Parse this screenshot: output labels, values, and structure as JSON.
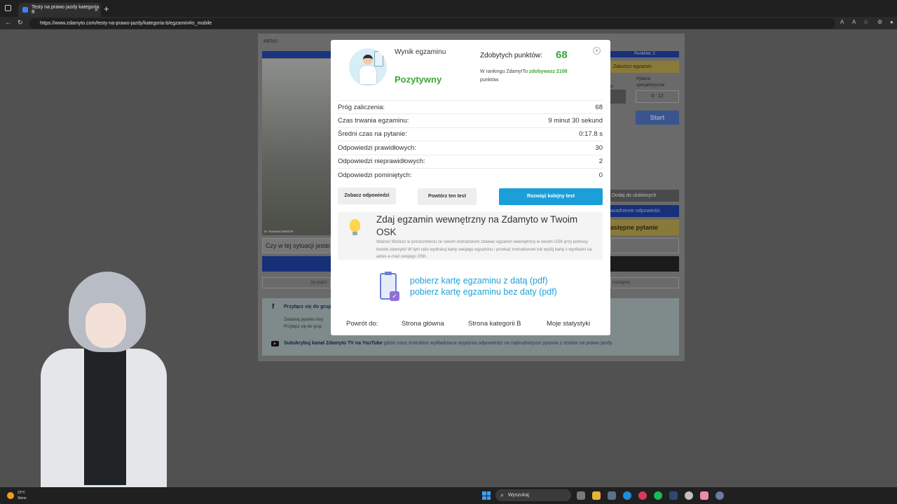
{
  "browser": {
    "tab_title": "Testy na prawo jazdy kategoria B",
    "tab_close": "×",
    "new_tab": "+",
    "url": "https://www.zdamyto.com/testy-na-prawo-jazdy/kategoria-b/egzamin#is_mobile"
  },
  "background_page": {
    "menu_label": "MENU",
    "question_text": "Czy w tej sytuacji jesteś",
    "prev_label": "(k) poprz",
    "next_label": "następne",
    "photo_caption": "ID: 3118/2A/C3/000278",
    "right": {
      "points_label": "Punktów: 2",
      "finish_button": "Zakończ egzamin",
      "basic_label": "e:",
      "special_label": "Pytania specjalistyczne",
      "timer": "0 : 12",
      "start_button": "Start",
      "favorites_button": "Dodaj do ulubionych",
      "justification_button": "asadnienie odpowiedzi",
      "next_question_button": "astępne pytanie"
    },
    "social": {
      "join_header": "Przyłącz się do grup",
      "join_line1": "Zadawaj pytania inny",
      "join_line2": "Przyłącz się do grup",
      "yt_bold": "Subskrybuj kanał Zdamyto TV na YouTube",
      "yt_rest": " gdzie nasz instruktor wykładowca wyjaśnia odpowiedzi na najtrudniejsze pytania z testów na prawo jazdy."
    }
  },
  "modal": {
    "result_label": "Wynik egzaminu",
    "result_status": "Pozytywny",
    "points_label": "Zdobytych punktów:",
    "points_value": "68",
    "ranking_prefix": "W rankingu Zdamy!To ",
    "ranking_bold": "zdobywasz 2108",
    "ranking_suffix": " punktów.",
    "close_symbol": "×",
    "stats": [
      {
        "label": "Próg zaliczenia:",
        "value": "68"
      },
      {
        "label": "Czas trwania egzaminu:",
        "value": "9 minut 30 sekund"
      },
      {
        "label": "Średni czas na pytanie:",
        "value": "0:17.8 s"
      },
      {
        "label": "Odpowiedzi prawidłowych:",
        "value": "30"
      },
      {
        "label": "Odpowiedzi nieprawidłowych:",
        "value": "2"
      },
      {
        "label": "Odpowiedzi pominiętych:",
        "value": "0"
      }
    ],
    "buttons": {
      "show_answers": "Zobacz odpowiedzi",
      "repeat_test": "Powtórz ten test",
      "next_test": "Rozwiąż kolejny test"
    },
    "osk": {
      "title": "Zdaj egzamin wewnętrzny na Zdamyto w Twoim OSK",
      "desc": "Ważne! Możesz w porozumieniu ze swoim instruktorem zdawać egzamin wewnętrzny w swoim OSK przy pomocy testów zdamyto! W tym celu wydrukuj kartę swojego egzaminu i przekaż instruktorowi lub wyślij kartę z wynikami na adres e-mail swojego OSK."
    },
    "pdf_with_date": "pobierz kartę egzaminu z datą (pdf)",
    "pdf_without_date": "pobierz kartę egzaminu bez daty (pdf)",
    "footer": {
      "back_label": "Powrót do:",
      "home": "Strona główna",
      "category_b": "Strona kategorii B",
      "my_stats": "Moje statystyki"
    }
  },
  "taskbar": {
    "temp": "23°C",
    "weather": "Słone",
    "search_placeholder": "Wyszukaj"
  }
}
